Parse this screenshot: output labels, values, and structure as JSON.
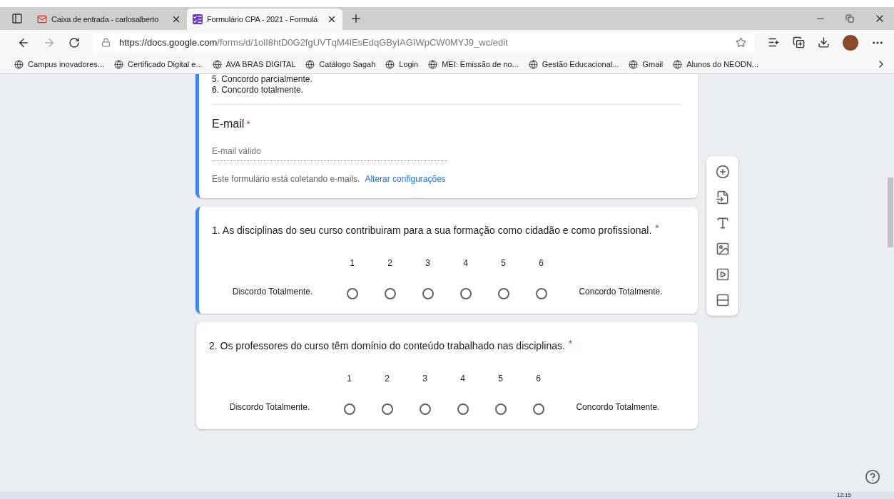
{
  "tabs": [
    {
      "title": "Caixa de entrada - carlosalberto",
      "kind": "mail",
      "selected": false
    },
    {
      "title": "Formulário CPA - 2021 - Formulá",
      "kind": "form",
      "selected": true
    }
  ],
  "address": {
    "host": "https://docs.google.com",
    "path": "/forms/d/1olI8htD0G2fgUVTqM4lEsEdqGByIAGIWpCW0MYJ9_wc/edit"
  },
  "bookmarks": [
    "Campus inovadores...",
    "Certificado Digital e...",
    "AVA BRAS DIGITAL",
    "Catálogo Sagah",
    "Login",
    "MEI: Emissão de no...",
    "Gestão Educacional...",
    "Gmail",
    "Alunos do NEODN..."
  ],
  "email_card": {
    "active": true,
    "options": [
      "5. Concordo parcialmente.",
      "6. Concordo totalmente."
    ],
    "title": "E-mail",
    "required": true,
    "required_mark": "*",
    "placeholder": "E-mail válido",
    "notice": "Este formulário está coletando e-mails.",
    "link": "Alterar configurações"
  },
  "questions": [
    {
      "active": true,
      "title": "1. As disciplinas do seu curso contribuiram para a sua formação como cidadão e como profissional.",
      "required": true,
      "required_mark": "*",
      "scale": [
        {
          "label": "1",
          "selected": false
        },
        {
          "label": "2",
          "selected": false
        },
        {
          "label": "3",
          "selected": false
        },
        {
          "label": "4",
          "selected": false
        },
        {
          "label": "5",
          "selected": false
        },
        {
          "label": "6",
          "selected": false
        }
      ],
      "low": "Discordo Totalmente.",
      "high": "Concordo Totalmente."
    },
    {
      "active": false,
      "title": "2. Os professores do curso têm domínio do conteúdo trabalhado nas disciplinas.",
      "required": true,
      "required_mark": "*",
      "scale": [
        {
          "label": "1",
          "selected": false
        },
        {
          "label": "2",
          "selected": false
        },
        {
          "label": "3",
          "selected": false
        },
        {
          "label": "4",
          "selected": false
        },
        {
          "label": "5",
          "selected": false
        },
        {
          "label": "6",
          "selected": false
        }
      ],
      "low": "Discordo Totalmente.",
      "high": "Concordo Totalmente."
    }
  ],
  "clock": "12:15"
}
